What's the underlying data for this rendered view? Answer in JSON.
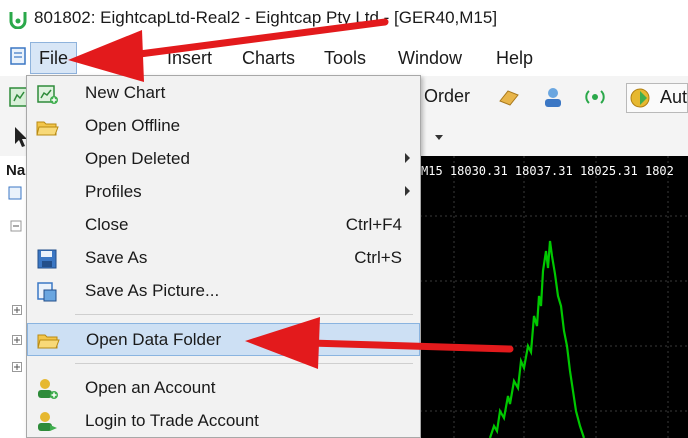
{
  "window": {
    "title": "801802: EightcapLtd-Real2 - Eightcap Pty Ltd - [GER40,M15]"
  },
  "menubar": {
    "items": [
      {
        "label": "File"
      },
      {
        "label": "Insert"
      },
      {
        "label": "Charts"
      },
      {
        "label": "Tools"
      },
      {
        "label": "Window"
      },
      {
        "label": "Help"
      }
    ]
  },
  "toolbar": {
    "new_order_label": "w Order",
    "auto_label": "Aut"
  },
  "navigator": {
    "label": "Na"
  },
  "chart": {
    "header_text": "M15  18030.31 18037.31 18025.31 1802"
  },
  "file_menu": {
    "items": [
      {
        "label": "New Chart",
        "icon": "new-chart-icon"
      },
      {
        "label": "Open Offline",
        "icon": "open-offline-icon"
      },
      {
        "label": "Open Deleted",
        "submenu": true
      },
      {
        "label": "Profiles",
        "submenu": true
      },
      {
        "label": "Close",
        "shortcut": "Ctrl+F4"
      },
      {
        "label": "Save As",
        "shortcut": "Ctrl+S",
        "icon": "save-icon"
      },
      {
        "label": "Save As Picture...",
        "icon": "save-picture-icon"
      },
      {
        "label": "Open Data Folder",
        "icon": "folder-icon",
        "highlighted": true
      },
      {
        "label": "Open an Account",
        "icon": "user-add-icon"
      },
      {
        "label": "Login to Trade Account",
        "icon": "login-icon"
      }
    ]
  },
  "colors": {
    "annotation_arrow": "#e31a1c",
    "chart_candles": "#00c800",
    "highlight": "#cde0f4"
  }
}
